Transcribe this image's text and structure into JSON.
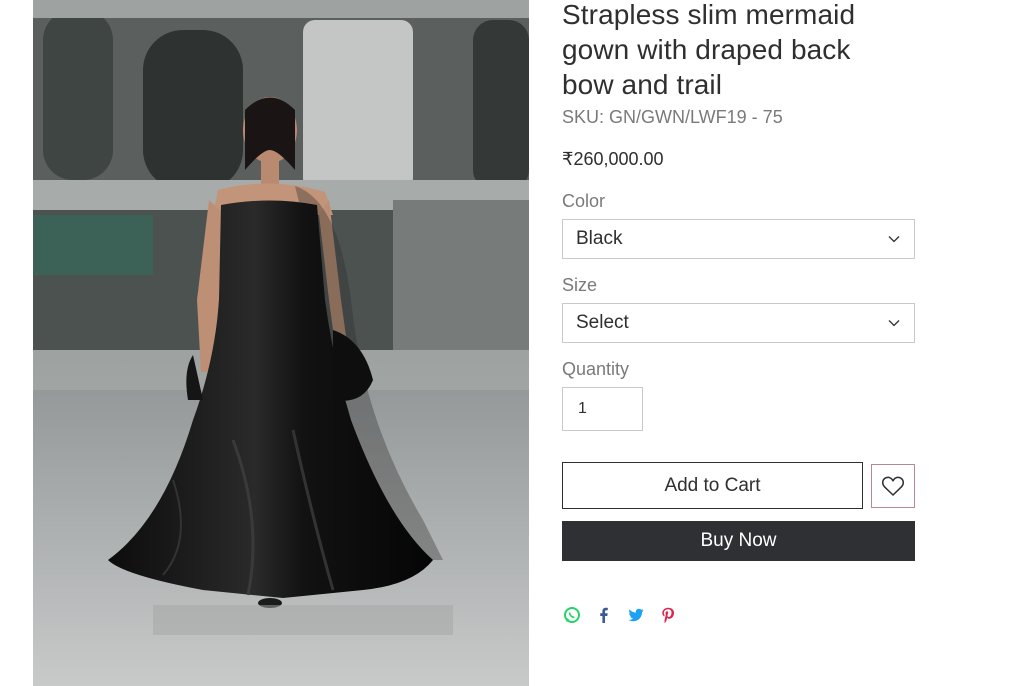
{
  "product": {
    "title": "Strapless slim mermaid gown with draped back bow and trail",
    "sku": "SKU: GN/GWN/LWF19 - 75",
    "price": "₹260,000.00"
  },
  "options": {
    "color": {
      "label": "Color",
      "selected": "Black"
    },
    "size": {
      "label": "Size",
      "selected": "Select"
    }
  },
  "quantity": {
    "label": "Quantity",
    "value": "1"
  },
  "actions": {
    "add_to_cart": "Add to Cart",
    "buy_now": "Buy Now"
  },
  "share": {
    "icons": [
      "whatsapp-icon",
      "facebook-icon",
      "twitter-icon",
      "pinterest-icon"
    ],
    "colors": {
      "whatsapp": "#25d366",
      "facebook": "#3b5998",
      "twitter": "#1da1f2",
      "pinterest": "#e0234e"
    }
  },
  "theme": {
    "buy_now_bg": "#2f3033",
    "wishlist_border": "#b98890"
  }
}
